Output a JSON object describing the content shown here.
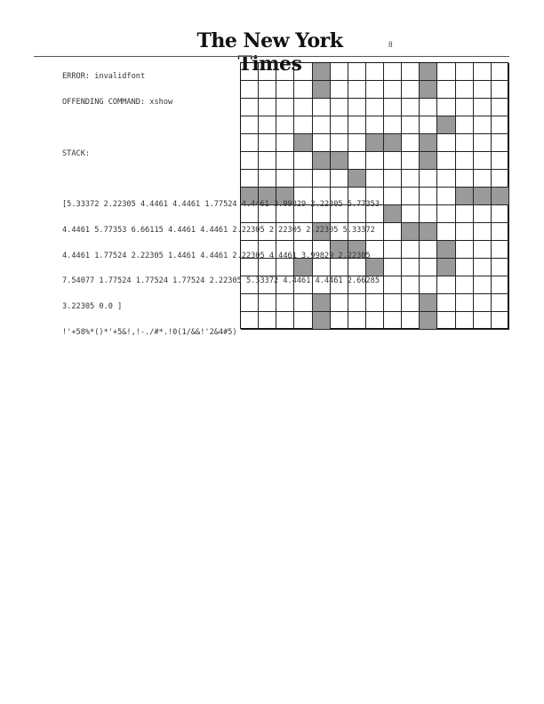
{
  "masthead": {
    "title": "The New York Times",
    "page_number": "8"
  },
  "error": {
    "lines": [
      "ERROR: invalidfont",
      "OFFENDING COMMAND: xshow",
      "",
      "STACK:",
      "",
      "[5.33372 2.22305 4.4461 4.4461 1.77524 4.4461 3.99829 2.22305 5.77353",
      "4.4461 5.77353 6.66115 4.4461 4.4461 2.22305 2.22305 2.22305 5.33372",
      "4.4461 1.77524 2.22305 1.4461 4.4461 2.22305 4.4461 3.99829 2.22305",
      "7.54077 1.77524 1.77524 1.77524 2.22305 5.33372 4.4461 4.4461 2.66285",
      "3.22305 0.0 ]",
      "!'+58%*()*'+5&!,!-./#*.!0(1/&&!'2&4#5)"
    ]
  },
  "crossword": {
    "rows": 15,
    "cols": 15,
    "black_cells": [
      [
        0,
        4
      ],
      [
        0,
        10
      ],
      [
        1,
        4
      ],
      [
        1,
        10
      ],
      [
        3,
        11
      ],
      [
        4,
        3
      ],
      [
        4,
        7
      ],
      [
        4,
        8
      ],
      [
        4,
        10
      ],
      [
        5,
        4
      ],
      [
        5,
        5
      ],
      [
        5,
        10
      ],
      [
        6,
        6
      ],
      [
        7,
        0
      ],
      [
        7,
        1
      ],
      [
        7,
        2
      ],
      [
        7,
        12
      ],
      [
        7,
        13
      ],
      [
        7,
        14
      ],
      [
        8,
        8
      ],
      [
        9,
        4
      ],
      [
        9,
        9
      ],
      [
        9,
        10
      ],
      [
        10,
        5
      ],
      [
        10,
        6
      ],
      [
        10,
        11
      ],
      [
        11,
        3
      ],
      [
        11,
        7
      ],
      [
        11,
        11
      ],
      [
        13,
        4
      ],
      [
        13,
        10
      ],
      [
        14,
        4
      ],
      [
        14,
        10
      ]
    ]
  }
}
